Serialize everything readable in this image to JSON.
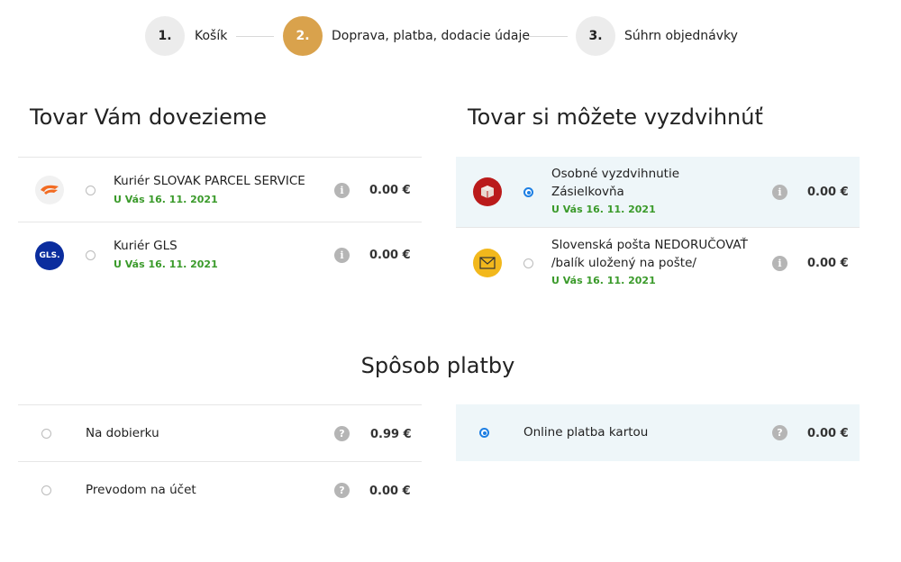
{
  "stepper": {
    "steps": [
      {
        "number": "1.",
        "label": "Košík"
      },
      {
        "number": "2.",
        "label": "Doprava, platba, dodacie údaje"
      },
      {
        "number": "3.",
        "label": "Súhrn objednávky"
      }
    ],
    "active_step": 2,
    "accent_color": "#d9a24c"
  },
  "delivery": {
    "title": "Tovar Vám dovezieme",
    "options": [
      {
        "name": "Kuriér SLOVAK PARCEL SERVICE",
        "date": "U Vás 16. 11. 2021",
        "price": "0.00 €",
        "icon": "sps-logo-icon",
        "selected": false
      },
      {
        "name": "Kuriér GLS",
        "date": "U Vás 16. 11. 2021",
        "price": "0.00 €",
        "icon": "gls-logo-icon",
        "logo_text": "GLS.",
        "selected": false
      }
    ]
  },
  "pickup": {
    "title": "Tovar si môžete vyzdvihnúť",
    "options": [
      {
        "name_line1": "Osobné vyzdvihnutie",
        "name_line2": "Zásielkovňa",
        "date": "U Vás 16. 11. 2021",
        "price": "0.00 €",
        "icon": "zasielkovna-logo-icon",
        "selected": true
      },
      {
        "name_line1": "Slovenská pošta NEDORUČOVAŤ",
        "name_line2": "/balík uložený na pošte/",
        "date": "U Vás 16. 11. 2021",
        "price": "0.00 €",
        "icon": "posta-logo-icon",
        "selected": false
      }
    ]
  },
  "payment": {
    "title": "Spôsob platby",
    "options": [
      {
        "name": "Na dobierku",
        "price": "0.99 €",
        "selected": false
      },
      {
        "name": "Prevodom na účet",
        "price": "0.00 €",
        "selected": false
      },
      {
        "name": "Online platba kartou",
        "price": "0.00 €",
        "selected": true
      }
    ]
  },
  "icons": {
    "info": "i",
    "help": "?"
  },
  "colors": {
    "date_green": "#3a9a2a",
    "radio_blue": "#1d7fe3",
    "selected_bg": "#eef6f9"
  }
}
